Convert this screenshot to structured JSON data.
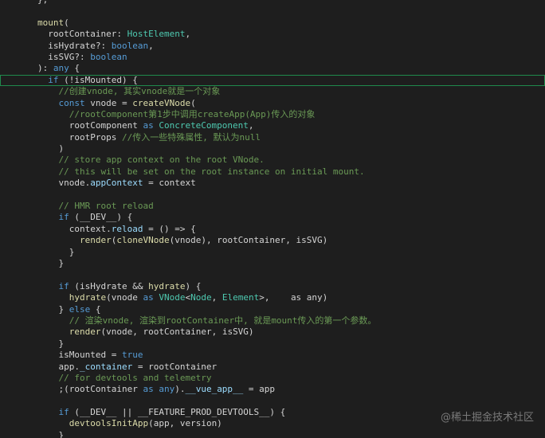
{
  "colors": {
    "background": "#1e1e1e",
    "current_line_border": "#1f8a4c",
    "function": "#dcdcaa",
    "keyword": "#569cd6",
    "control": "#c586c0",
    "type": "#4ec9b0",
    "property": "#9cdcfe",
    "comment": "#6a9955",
    "text": "#d4d4d4"
  },
  "code_lines": [
    {
      "tokens": [
        [
          "pl",
          "},"
        ]
      ]
    },
    {
      "tokens": []
    },
    {
      "tokens": [
        [
          "fn",
          "mount"
        ],
        [
          "pl",
          "("
        ]
      ]
    },
    {
      "tokens": [
        [
          "pl",
          "  rootContainer: "
        ],
        [
          "type",
          "HostElement"
        ],
        [
          "pl",
          ","
        ]
      ]
    },
    {
      "tokens": [
        [
          "pl",
          "  isHydrate?: "
        ],
        [
          "kw",
          "boolean"
        ],
        [
          "pl",
          ","
        ]
      ]
    },
    {
      "tokens": [
        [
          "pl",
          "  isSVG?: "
        ],
        [
          "kw",
          "boolean"
        ]
      ]
    },
    {
      "tokens": [
        [
          "pl",
          "): "
        ],
        [
          "kw",
          "any"
        ],
        [
          "pl",
          " {"
        ]
      ]
    },
    {
      "current": true,
      "tokens": [
        [
          "pl",
          "  "
        ],
        [
          "kw",
          "if"
        ],
        [
          "pl",
          " (!isMounted) {"
        ]
      ]
    },
    {
      "tokens": [
        [
          "pl",
          "    "
        ],
        [
          "cm",
          "//创建vnode, 其实vnode就是一个对象"
        ]
      ]
    },
    {
      "tokens": [
        [
          "pl",
          "    "
        ],
        [
          "kw",
          "const"
        ],
        [
          "pl",
          " vnode = "
        ],
        [
          "fn",
          "createVNode"
        ],
        [
          "pl",
          "("
        ]
      ]
    },
    {
      "tokens": [
        [
          "pl",
          "      "
        ],
        [
          "cm",
          "//rootComponent第1步中调用createApp(App)传入的对象"
        ]
      ]
    },
    {
      "tokens": [
        [
          "pl",
          "      rootComponent "
        ],
        [
          "kw",
          "as"
        ],
        [
          "pl",
          " "
        ],
        [
          "type",
          "ConcreteComponent"
        ],
        [
          "pl",
          ","
        ]
      ]
    },
    {
      "tokens": [
        [
          "pl",
          "      rootProps "
        ],
        [
          "cm",
          "//传入一些特殊属性, 默认为null"
        ]
      ]
    },
    {
      "tokens": [
        [
          "pl",
          "    )"
        ]
      ]
    },
    {
      "tokens": [
        [
          "pl",
          "    "
        ],
        [
          "cm",
          "// store app context on the root VNode."
        ]
      ]
    },
    {
      "tokens": [
        [
          "pl",
          "    "
        ],
        [
          "cm",
          "// this will be set on the root instance on initial mount."
        ]
      ]
    },
    {
      "tokens": [
        [
          "pl",
          "    vnode."
        ],
        [
          "prop",
          "appContext"
        ],
        [
          "pl",
          " = context"
        ]
      ]
    },
    {
      "tokens": []
    },
    {
      "tokens": [
        [
          "pl",
          "    "
        ],
        [
          "cm",
          "// HMR root reload"
        ]
      ]
    },
    {
      "tokens": [
        [
          "pl",
          "    "
        ],
        [
          "kw",
          "if"
        ],
        [
          "pl",
          " (__DEV__) {"
        ]
      ]
    },
    {
      "tokens": [
        [
          "pl",
          "      context."
        ],
        [
          "prop",
          "reload"
        ],
        [
          "pl",
          " = () => {"
        ]
      ]
    },
    {
      "tokens": [
        [
          "pl",
          "        "
        ],
        [
          "fn",
          "render"
        ],
        [
          "pl",
          "("
        ],
        [
          "fn",
          "cloneVNode"
        ],
        [
          "pl",
          "(vnode), rootContainer, isSVG)"
        ]
      ]
    },
    {
      "tokens": [
        [
          "pl",
          "      }"
        ]
      ]
    },
    {
      "tokens": [
        [
          "pl",
          "    }"
        ]
      ]
    },
    {
      "tokens": []
    },
    {
      "tokens": [
        [
          "pl",
          "    "
        ],
        [
          "kw",
          "if"
        ],
        [
          "pl",
          " (isHydrate && "
        ],
        [
          "fn",
          "hydrate"
        ],
        [
          "pl",
          ") {"
        ]
      ]
    },
    {
      "tokens": [
        [
          "pl",
          "      "
        ],
        [
          "fn",
          "hydrate"
        ],
        [
          "pl",
          "(vnode "
        ],
        [
          "kw",
          "as"
        ],
        [
          "pl",
          " "
        ],
        [
          "type",
          "VNode"
        ],
        [
          "pl",
          "<"
        ],
        [
          "type",
          "Node"
        ],
        [
          "pl",
          ", "
        ],
        [
          "type",
          "Element"
        ],
        [
          "pl",
          ">,    as any)"
        ]
      ]
    },
    {
      "tokens": [
        [
          "pl",
          "    } "
        ],
        [
          "kw",
          "else"
        ],
        [
          "pl",
          " {"
        ]
      ]
    },
    {
      "tokens": [
        [
          "pl",
          "      "
        ],
        [
          "cm",
          "// 渲染vnode, 渲染到rootContainer中, 就是mount传入的第一个参数。"
        ]
      ]
    },
    {
      "tokens": [
        [
          "pl",
          "      "
        ],
        [
          "fn",
          "render"
        ],
        [
          "pl",
          "(vnode, rootContainer, isSVG)"
        ]
      ]
    },
    {
      "tokens": [
        [
          "pl",
          "    }"
        ]
      ]
    },
    {
      "tokens": [
        [
          "pl",
          "    isMounted = "
        ],
        [
          "lit",
          "true"
        ]
      ]
    },
    {
      "tokens": [
        [
          "pl",
          "    app."
        ],
        [
          "prop",
          "_container"
        ],
        [
          "pl",
          " = rootContainer"
        ]
      ]
    },
    {
      "tokens": [
        [
          "pl",
          "    "
        ],
        [
          "cm",
          "// for devtools and telemetry"
        ]
      ]
    },
    {
      "tokens": [
        [
          "pl",
          "    ;(rootContainer "
        ],
        [
          "kw",
          "as"
        ],
        [
          "pl",
          " "
        ],
        [
          "kw",
          "any"
        ],
        [
          "pl",
          ")."
        ],
        [
          "prop",
          "__vue_app__"
        ],
        [
          "pl",
          " = app"
        ]
      ]
    },
    {
      "tokens": []
    },
    {
      "tokens": [
        [
          "pl",
          "    "
        ],
        [
          "kw",
          "if"
        ],
        [
          "pl",
          " (__DEV__ || __FEATURE_PROD_DEVTOOLS__) {"
        ]
      ]
    },
    {
      "tokens": [
        [
          "pl",
          "      "
        ],
        [
          "fn",
          "devtoolsInitApp"
        ],
        [
          "pl",
          "(app, version)"
        ]
      ]
    },
    {
      "tokens": [
        [
          "pl",
          "    }"
        ]
      ]
    }
  ],
  "watermark": "@稀土掘金技术社区"
}
